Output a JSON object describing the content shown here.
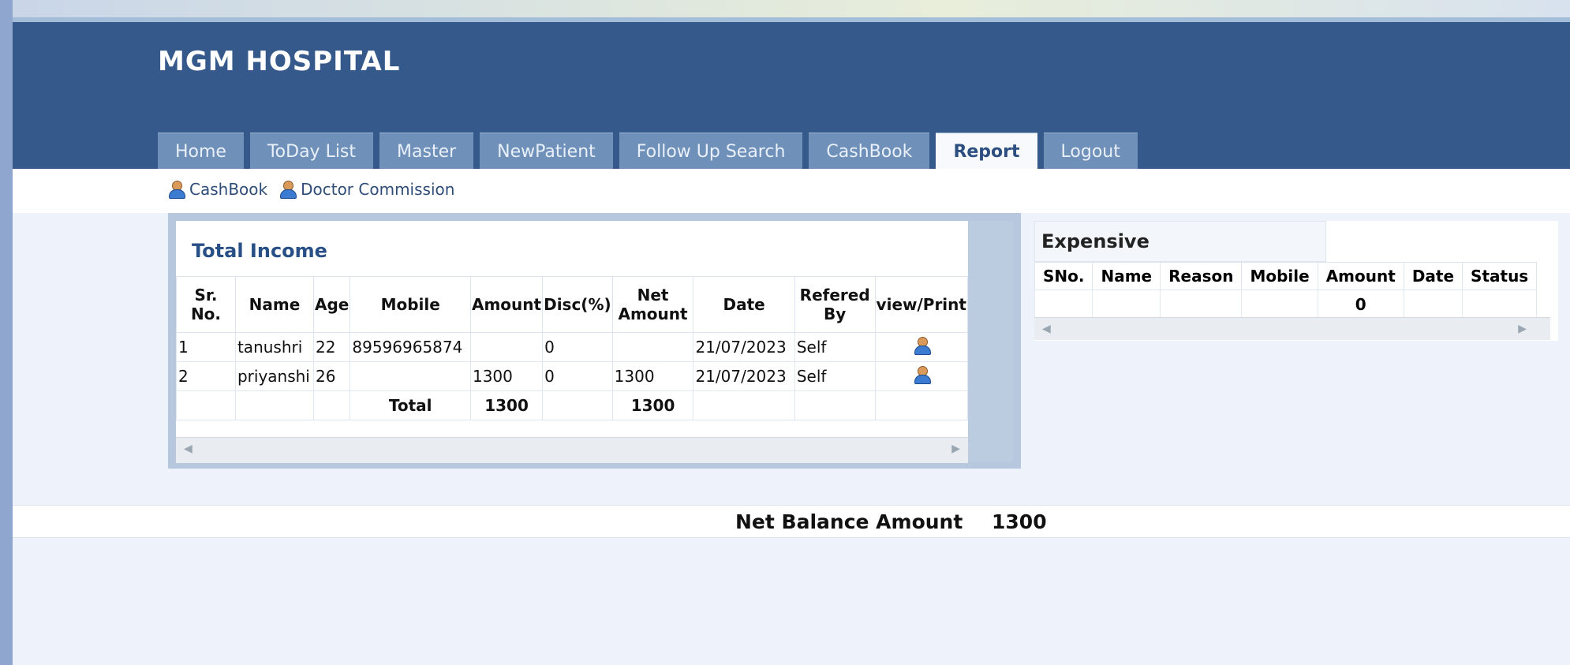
{
  "app": {
    "brand": "MGM HOSPITAL"
  },
  "nav": {
    "tabs": [
      "Home",
      "ToDay List",
      "Master",
      "NewPatient",
      "Follow Up Search",
      "CashBook",
      "Report",
      "Logout"
    ],
    "active": "Report"
  },
  "subnav": {
    "links": [
      "CashBook",
      "Doctor Commission"
    ]
  },
  "income": {
    "title": "Total Income",
    "columns": [
      "Sr. No.",
      "Name",
      "Age",
      "Mobile",
      "Amount",
      "Disc(%)",
      "Net Amount",
      "Date",
      "Refered By",
      "view/Print"
    ],
    "rows": [
      {
        "sr": "1",
        "name": "tanushri",
        "age": "22",
        "mobile": "89596965874",
        "amount": "",
        "disc": "0",
        "net": "",
        "date": "21/07/2023",
        "ref": "Self"
      },
      {
        "sr": "2",
        "name": "priyanshi",
        "age": "26",
        "mobile": "",
        "amount": "1300",
        "disc": "0",
        "net": "1300",
        "date": "21/07/2023",
        "ref": "Self"
      }
    ],
    "total": {
      "label": "Total",
      "amount": "1300",
      "net": "1300"
    }
  },
  "expense": {
    "title": "Expensive",
    "columns": [
      "SNo.",
      "Name",
      "Reason",
      "Mobile",
      "Amount",
      "Date",
      "Status"
    ],
    "row": {
      "amount": "0"
    }
  },
  "balance": {
    "label": "Net Balance Amount",
    "value": "1300"
  }
}
